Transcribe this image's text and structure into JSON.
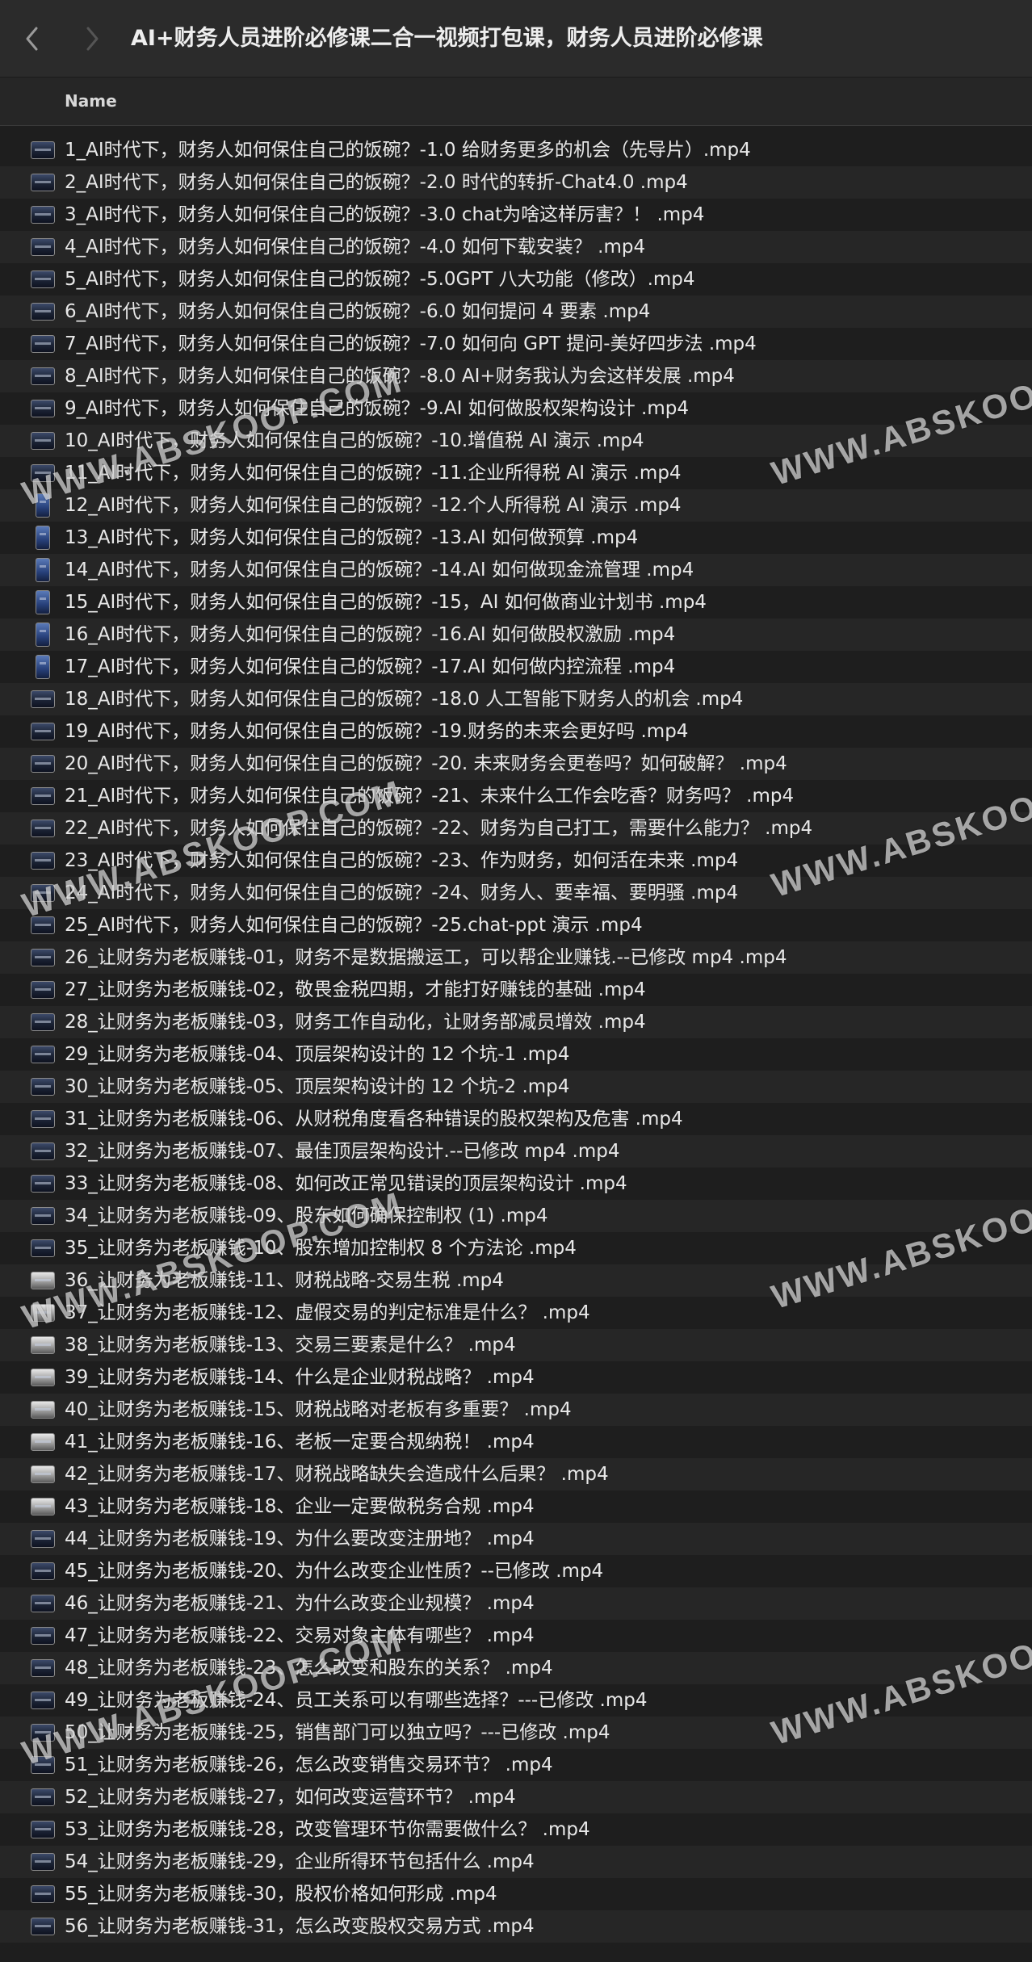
{
  "window": {
    "title": "AI+财务人员进阶必修课二合一视频打包课，财务人员进阶必修课"
  },
  "column": {
    "name": "Name"
  },
  "watermark": "WWW.ABSKOOP.COM",
  "files": [
    "1_AI时代下，财务人如何保住自己的饭碗？-1.0 给财务更多的机会（先导片）.mp4",
    "2_AI时代下，财务人如何保住自己的饭碗？-2.0 时代的转折-Chat4.0 .mp4",
    "3_AI时代下，财务人如何保住自己的饭碗？-3.0 chat为啥这样厉害？！ .mp4",
    "4_AI时代下，财务人如何保住自己的饭碗？-4.0 如何下载安装？ .mp4",
    "5_AI时代下，财务人如何保住自己的饭碗？-5.0GPT 八大功能（修改）.mp4",
    "6_AI时代下，财务人如何保住自己的饭碗？-6.0 如何提问 4 要素 .mp4",
    "7_AI时代下，财务人如何保住自己的饭碗？-7.0 如何向 GPT 提问-美好四步法 .mp4",
    "8_AI时代下，财务人如何保住自己的饭碗？-8.0 AI+财务我认为会这样发展 .mp4",
    "9_AI时代下，财务人如何保住自己的饭碗？-9.AI 如何做股权架构设计 .mp4",
    "10_AI时代下，财务人如何保住自己的饭碗？-10.增值税 AI 演示 .mp4",
    "11_AI时代下，财务人如何保住自己的饭碗？-11.企业所得税 AI 演示 .mp4",
    "12_AI时代下，财务人如何保住自己的饭碗？-12.个人所得税 AI 演示 .mp4",
    "13_AI时代下，财务人如何保住自己的饭碗？-13.AI 如何做预算 .mp4",
    "14_AI时代下，财务人如何保住自己的饭碗？-14.AI 如何做现金流管理 .mp4",
    "15_AI时代下，财务人如何保住自己的饭碗？-15，AI 如何做商业计划书 .mp4",
    "16_AI时代下，财务人如何保住自己的饭碗？-16.AI 如何做股权激励 .mp4",
    "17_AI时代下，财务人如何保住自己的饭碗？-17.AI 如何做内控流程 .mp4",
    "18_AI时代下，财务人如何保住自己的饭碗？-18.0 人工智能下财务人的机会 .mp4",
    "19_AI时代下，财务人如何保住自己的饭碗？-19.财务的未来会更好吗 .mp4",
    "20_AI时代下，财务人如何保住自己的饭碗？-20. 未来财务会更卷吗？如何破解？ .mp4",
    "21_AI时代下，财务人如何保住自己的饭碗？-21、未来什么工作会吃香？财务吗？ .mp4",
    "22_AI时代下，财务人如何保住自己的饭碗？-22、财务为自己打工，需要什么能力？ .mp4",
    "23_AI时代下，财务人如何保住自己的饭碗？-23、作为财务，如何活在未来 .mp4",
    "24_AI时代下，财务人如何保住自己的饭碗？-24、财务人、要幸福、要明骚 .mp4",
    "25_AI时代下，财务人如何保住自己的饭碗？-25.chat-ppt 演示 .mp4",
    "26_让财务为老板赚钱-01，财务不是数据搬运工，可以帮企业赚钱.--已修改 mp4 .mp4",
    "27_让财务为老板赚钱-02，敬畏金税四期，才能打好赚钱的基础 .mp4",
    "28_让财务为老板赚钱-03，财务工作自动化，让财务部减员增效 .mp4",
    "29_让财务为老板赚钱-04、顶层架构设计的 12 个坑-1 .mp4",
    "30_让财务为老板赚钱-05、顶层架构设计的 12 个坑-2 .mp4",
    "31_让财务为老板赚钱-06、从财税角度看各种错误的股权架构及危害 .mp4",
    "32_让财务为老板赚钱-07、最佳顶层架构设计.--已修改 mp4 .mp4",
    "33_让财务为老板赚钱-08、如何改正常见错误的顶层架构设计 .mp4",
    "34_让财务为老板赚钱-09、股东如何确保控制权 (1) .mp4",
    "35_让财务为老板赚钱-10、股东增加控制权 8 个方法论 .mp4",
    "36_让财务为老板赚钱-11、财税战略-交易生税 .mp4",
    "37_让财务为老板赚钱-12、虚假交易的判定标准是什么？ .mp4",
    "38_让财务为老板赚钱-13、交易三要素是什么？ .mp4",
    "39_让财务为老板赚钱-14、什么是企业财税战略？ .mp4",
    "40_让财务为老板赚钱-15、财税战略对老板有多重要？ .mp4",
    "41_让财务为老板赚钱-16、老板一定要合规纳税！ .mp4",
    "42_让财务为老板赚钱-17、财税战略缺失会造成什么后果？ .mp4",
    "43_让财务为老板赚钱-18、企业一定要做税务合规 .mp4",
    "44_让财务为老板赚钱-19、为什么要改变注册地？ .mp4",
    "45_让财务为老板赚钱-20、为什么改变企业性质？--已修改 .mp4",
    "46_让财务为老板赚钱-21、为什么改变企业规模？ .mp4",
    "47_让财务为老板赚钱-22、交易对象主体有哪些？ .mp4",
    "48_让财务为老板赚钱-23、怎么改变和股东的关系？ .mp4",
    "49_让财务为老板赚钱-24、员工关系可以有哪些选择？---已修改 .mp4",
    "50_让财务为老板赚钱-25，销售部门可以独立吗？---已修改 .mp4",
    "51_让财务为老板赚钱-26，怎么改变销售交易环节？ .mp4",
    "52_让财务为老板赚钱-27，如何改变运营环节？ .mp4",
    "53_让财务为老板赚钱-28，改变管理环节你需要做什么？ .mp4",
    "54_让财务为老板赚钱-29，企业所得环节包括什么 .mp4",
    "55_让财务为老板赚钱-30，股权价格如何形成 .mp4",
    "56_让财务为老板赚钱-31，怎么改变股权交易方式 .mp4"
  ]
}
